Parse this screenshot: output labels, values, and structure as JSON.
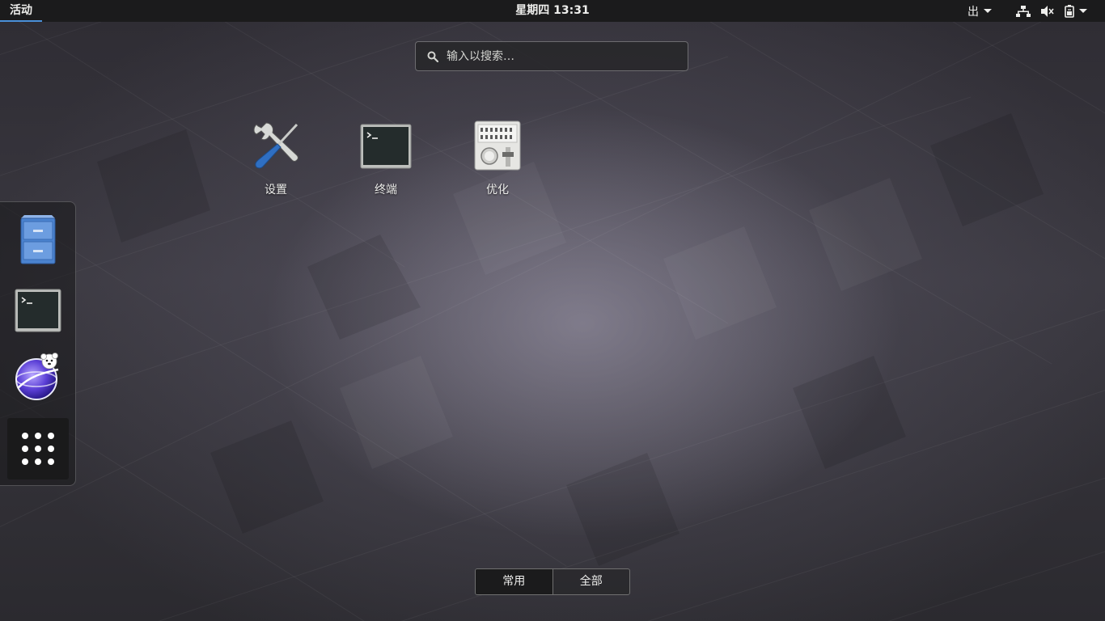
{
  "topbar": {
    "activities_label": "活动",
    "clock": "星期四 13:31",
    "input_method_label": "出",
    "tray_icons": [
      "network-wired-icon",
      "volume-muted-icon",
      "battery-icon"
    ]
  },
  "search": {
    "placeholder": "输入以搜索…"
  },
  "app_grid": {
    "apps": [
      {
        "label": "设置",
        "icon": "settings-tools-icon"
      },
      {
        "label": "终端",
        "icon": "terminal-icon"
      },
      {
        "label": "优化",
        "icon": "tweaks-mixer-icon"
      }
    ]
  },
  "dash": {
    "items": [
      {
        "icon": "file-cabinet-icon"
      },
      {
        "icon": "terminal-icon"
      },
      {
        "icon": "web-browser-globe-icon"
      },
      {
        "icon": "show-applications-grid-icon"
      }
    ]
  },
  "view_switch": {
    "frequent_label": "常用",
    "all_label": "全部",
    "active": "frequent"
  },
  "colors": {
    "topbar_bg": "#1b1b1c",
    "accent": "#4a90d9",
    "text": "#eeeeec"
  }
}
